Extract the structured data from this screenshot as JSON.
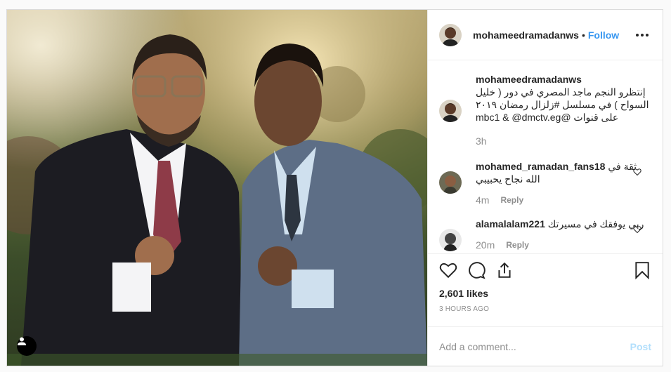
{
  "post": {
    "username": "mohameedramadanws",
    "dot": "•",
    "follow_label": "Follow",
    "photo_icon": "tag-user-icon",
    "likes": "2,601 likes",
    "timestamp": "3 HOURS AGO",
    "add_comment_placeholder": "Add a comment...",
    "post_label": "Post",
    "colors": {
      "accent": "#3897f0",
      "post_disabled": "#b2dffc",
      "muted": "#8e8e8e"
    }
  },
  "caption": {
    "username": "mohameedramadanws",
    "text": "إنتظرو النجم ماجد المصري في دور ( خليل السواح ) في مسلسل #زلزال رمضان ٢٠١٩ على قنوات @mbc1 & @dmctv.eg",
    "time": "3h"
  },
  "comments": [
    {
      "username": "mohamed_ramadan_fans18",
      "text": "ثقة في الله نجاح يحبيبي",
      "time": "4m",
      "reply": "Reply"
    },
    {
      "username": "alamalalam221",
      "text": "ربي يوفقك في مسيرتك",
      "time": "20m",
      "reply": "Reply"
    }
  ]
}
